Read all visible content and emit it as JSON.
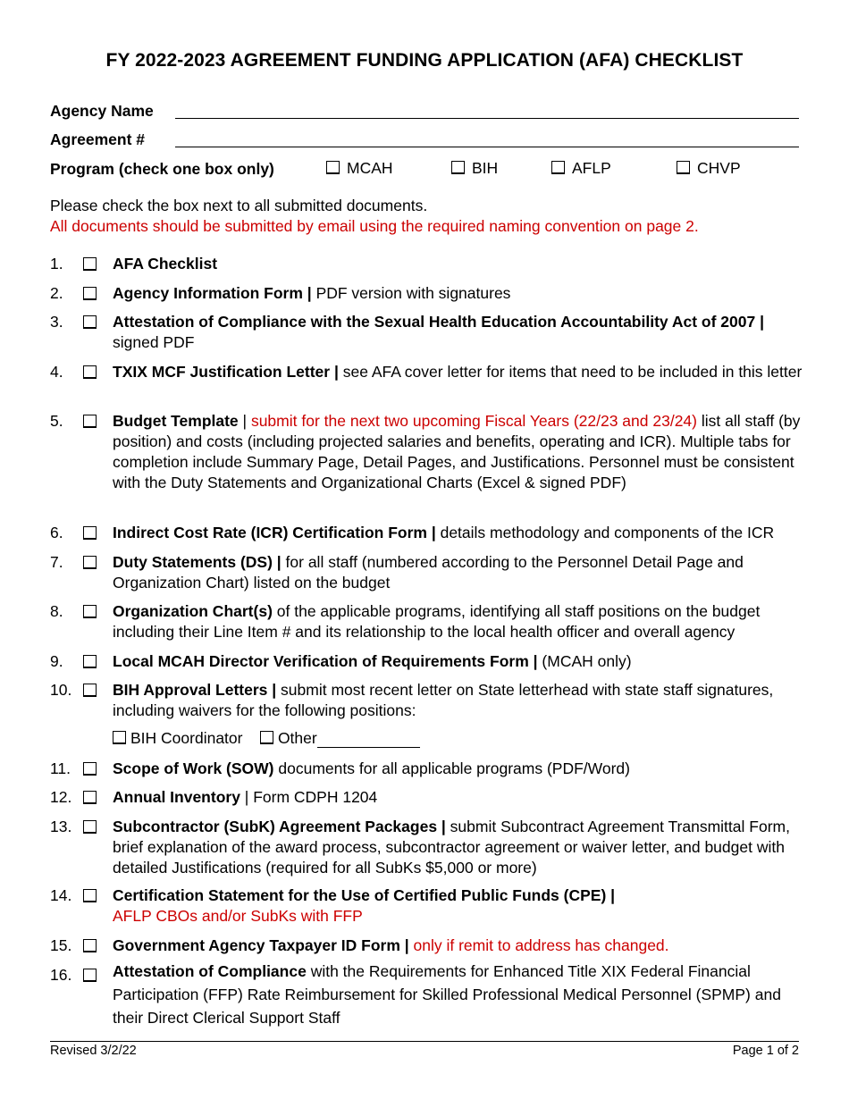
{
  "title": "FY 2022-2023 AGREEMENT FUNDING APPLICATION (AFA) CHECKLIST",
  "fields": {
    "agency_name_label": "Agency Name",
    "agency_name_value": "",
    "agreement_label": "Agreement #",
    "agreement_value": "",
    "program_label": "Program (check one box only)",
    "programs": [
      "MCAH",
      "BIH",
      "AFLP",
      "CHVP"
    ]
  },
  "intro": {
    "line1": "Please check the box next to all submitted documents.",
    "line2": "All documents should be submitted by email using the required naming convention on page 2."
  },
  "colors": {
    "accent_red": "#cc0000"
  },
  "items": [
    {
      "num": "1.",
      "bold": "AFA Checklist",
      "sep": "",
      "red": "",
      "rest": ""
    },
    {
      "num": "2.",
      "bold": "Agency Information Form |",
      "sep": "",
      "red": "",
      "rest": " PDF version with signatures"
    },
    {
      "num": "3.",
      "bold": "Attestation of Compliance with the Sexual Health Education Accountability Act of 2007 |",
      "sep": "",
      "red": "",
      "rest": " signed PDF"
    },
    {
      "num": "4.",
      "bold": "TXIX MCF Justification Letter |",
      "sep": "",
      "red": "",
      "rest": " see AFA cover letter for items that need to be included in this letter"
    },
    {
      "num": "5.",
      "bold": "Budget Template",
      "sep": " | ",
      "red": "submit for the next two upcoming Fiscal Years (22/23 and 23/24)",
      "rest": " list all staff (by position) and costs (including projected salaries and benefits, operating and ICR). Multiple tabs for completion include Summary Page, Detail Pages, and Justifications. Personnel must be consistent with the Duty Statements and Organizational Charts (Excel & signed PDF)"
    },
    {
      "num": "6.",
      "bold": "Indirect Cost Rate (ICR) Certification Form |",
      "sep": "",
      "red": "",
      "rest": " details methodology and components of the ICR"
    },
    {
      "num": "7.",
      "bold": "Duty Statements (DS) |",
      "sep": "",
      "red": "",
      "rest": " for all staff (numbered according to the Personnel Detail Page and Organization Chart) listed on the budget"
    },
    {
      "num": "8.",
      "bold": "Organization Chart(s)",
      "sep": "",
      "red": "",
      "rest": " of the applicable programs, identifying all staff positions on the budget including their Line Item # and its relationship to the local health officer and overall agency"
    },
    {
      "num": "9.",
      "bold": "Local MCAH Director Verification of Requirements Form |",
      "sep": "",
      "red": "",
      "rest": " (MCAH only)"
    },
    {
      "num": "10.",
      "bold": "BIH Approval Letters |",
      "sep": "",
      "red": "",
      "rest": " submit most recent letter on State letterhead with state staff signatures, including waivers for the following positions:"
    },
    {
      "num": "11.",
      "bold": "Scope of Work (SOW)",
      "sep": "",
      "red": "",
      "rest": " documents for all applicable programs (PDF/Word)"
    },
    {
      "num": "12.",
      "bold": "Annual Inventory",
      "sep": "",
      "red": "",
      "rest": " | Form CDPH 1204"
    },
    {
      "num": "13.",
      "bold": "Subcontractor (SubK) Agreement Packages |",
      "sep": "",
      "red": "",
      "rest": " submit Subcontract Agreement Transmittal Form, brief explanation of the award process, subcontractor agreement or waiver letter, and budget with detailed Justifications (required for all SubKs $5,000 or more)"
    },
    {
      "num": "14.",
      "bold": "Certification Statement for the Use of Certified Public Funds (CPE) |",
      "sep": " ",
      "red": "AFLP CBOs and/or SubKs with FFP",
      "rest": ""
    },
    {
      "num": "15.",
      "bold": "Government Agency Taxpayer ID Form |",
      "sep": " ",
      "red": "only if remit to address has changed.",
      "rest": ""
    },
    {
      "num": "16.",
      "bold": "Attestation of Compliance",
      "sep": "",
      "red": "",
      "rest": " with the Requirements for Enhanced Title XIX Federal Financial Participation (FFP) Rate Reimbursement for Skilled Professional Medical Personnel (SPMP) and their Direct Clerical Support Staff"
    }
  ],
  "bih_positions": {
    "coordinator": "BIH Coordinator",
    "other": "Other"
  },
  "footer": {
    "revised": "Revised 3/2/22",
    "page": "Page 1 of 2"
  }
}
